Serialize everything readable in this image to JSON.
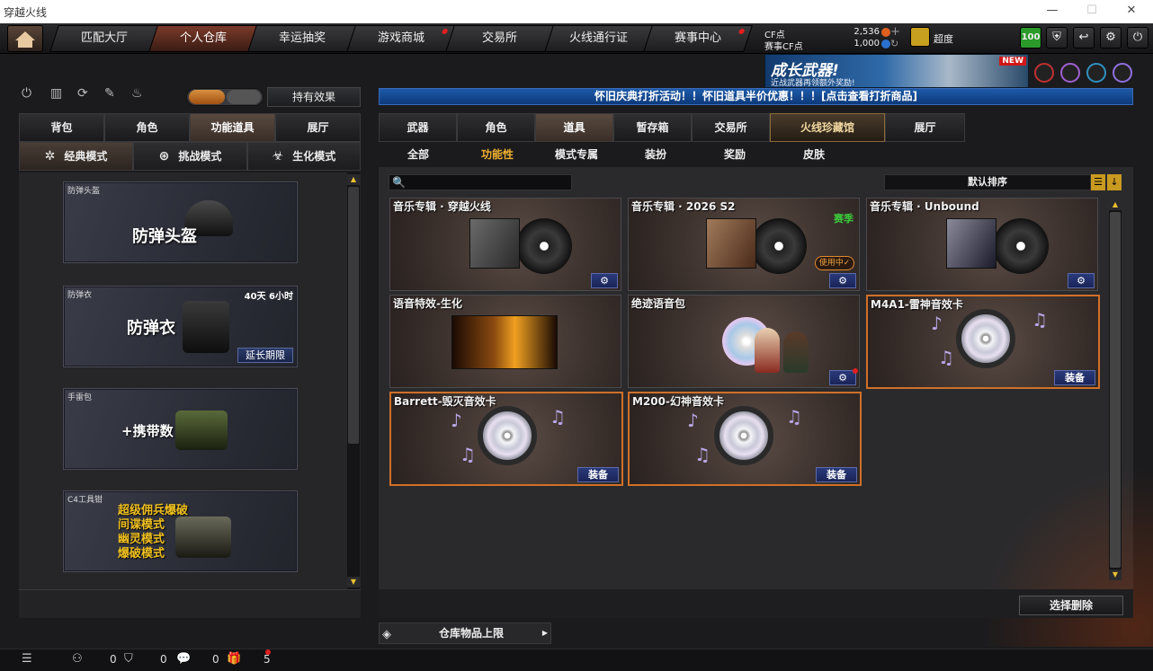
{
  "window": {
    "title": "穿越火线"
  },
  "nav": {
    "tabs": [
      {
        "label": "匹配大厅"
      },
      {
        "label": "个人仓库"
      },
      {
        "label": "幸运抽奖"
      },
      {
        "label": "游戏商城"
      },
      {
        "label": "交易所"
      },
      {
        "label": "火线通行证"
      },
      {
        "label": "赛事中心"
      }
    ]
  },
  "currency": {
    "cf_label": "CF点",
    "cf_value": "2,536",
    "match_label": "赛事CF点",
    "match_value": "1,000"
  },
  "user": {
    "name": "超度",
    "level": "100"
  },
  "banner": {
    "title": "成长武器!",
    "subtitle": "近战武器再领额外奖励!",
    "badge": "NEW"
  },
  "left": {
    "effect_button": "持有效果",
    "tabs": [
      {
        "label": "背包"
      },
      {
        "label": "角色"
      },
      {
        "label": "功能道具"
      },
      {
        "label": "展厅"
      }
    ],
    "modes": [
      {
        "label": "经典模式"
      },
      {
        "label": "挑战模式"
      },
      {
        "label": "生化模式"
      }
    ],
    "equipment": [
      {
        "name": "防弹头盔",
        "display": "防弹头盔"
      },
      {
        "name": "防弹衣",
        "display": "防弹衣",
        "time": "40天 6小时",
        "button": "延长期限"
      },
      {
        "name": "手雷包",
        "display": "+携带数"
      },
      {
        "name": "C4工具钳",
        "modes": [
          "超级佣兵爆破",
          "间谍模式",
          "幽灵模式",
          "爆破模式"
        ]
      }
    ]
  },
  "notice": "怀旧庆典打折活动！！怀旧道具半价优惠！！！[点击查看打折商品]",
  "right": {
    "tabs": [
      {
        "label": "武器"
      },
      {
        "label": "角色"
      },
      {
        "label": "道具"
      },
      {
        "label": "暂存箱"
      },
      {
        "label": "交易所"
      },
      {
        "label": "火线珍藏馆"
      },
      {
        "label": "展厅"
      }
    ],
    "subtabs": [
      {
        "label": "全部"
      },
      {
        "label": "功能性"
      },
      {
        "label": "模式专属"
      },
      {
        "label": "装扮"
      },
      {
        "label": "奖励"
      },
      {
        "label": "皮肤"
      }
    ],
    "sort_label": "默认排序",
    "items": [
      {
        "title": "音乐专辑 · 穿越火线"
      },
      {
        "title": "音乐专辑 · 2026 S2",
        "badge": "赛季",
        "status": "使用中✓"
      },
      {
        "title": "音乐专辑 · Unbound"
      },
      {
        "title": "语音特效-生化"
      },
      {
        "title": "绝迹语音包"
      },
      {
        "title": "M4A1-雷神音效卡",
        "button": "装备"
      },
      {
        "title": "Barrett-毁灭音效卡",
        "button": "装备"
      },
      {
        "title": "M200-幻神音效卡",
        "button": "装备"
      }
    ],
    "delete_button": "选择删除",
    "capacity_label": "仓库物品上限"
  },
  "footer": {
    "counts": [
      "0",
      "0",
      "0",
      "5"
    ]
  }
}
